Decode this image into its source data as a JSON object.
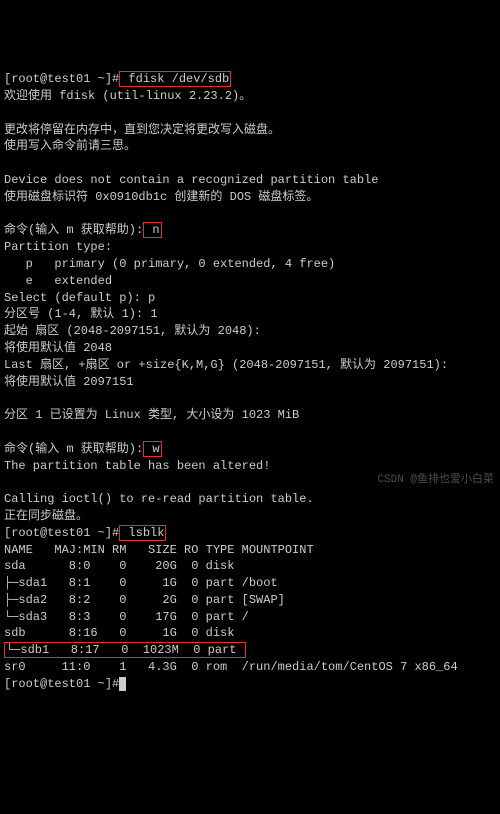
{
  "term": {
    "prompt1_prefix": "[root@test01 ~]#",
    "prompt1_suffix": "",
    "cmd_fdisk": " fdisk /dev/sdb",
    "welcome": "欢迎使用 fdisk (util-linux 2.23.2)。",
    "blank": "",
    "mem1": "更改将停留在内存中，直到您决定将更改写入磁盘。",
    "mem2": "使用写入命令前请三思。",
    "devwarn": "Device does not contain a recognized partition table",
    "devwarn2": "使用磁盘标识符 0x0910db1c 创建新的 DOS 磁盘标签。",
    "cmdprompt1a": "命令(输入 m 获取帮助):",
    "cmd_n": " n",
    "parttype": "Partition type:",
    "pt_p": "   p   primary (0 primary, 0 extended, 4 free)",
    "pt_e": "   e   extended",
    "select": "Select (default p): p",
    "partno": "分区号 (1-4, 默认 1): 1",
    "firstsector": "起始 扇区 (2048-2097151, 默认为 2048):",
    "usedefault1": "将使用默认值 2048",
    "lastsector": "Last 扇区, +扇区 or +size{K,M,G} (2048-2097151, 默认为 2097151):",
    "usedefault2": "将使用默认值 2097151",
    "setpart": "分区 1 已设置为 Linux 类型, 大小设为 1023 MiB",
    "cmdprompt2a": "命令(输入 m 获取帮助):",
    "cmd_w": " w",
    "altered": "The partition table has been altered!",
    "callioctl": "Calling ioctl() to re-read partition table.",
    "syncing": "正在同步磁盘。",
    "prompt2_prefix": "[root@test01 ~]#",
    "cmd_lsblk": " lsblk",
    "lsblk_header": "NAME   MAJ:MIN RM   SIZE RO TYPE MOUNTPOINT",
    "lsblk_sda": "sda      8:0    0    20G  0 disk ",
    "lsblk_sda1": "├─sda1   8:1    0     1G  0 part /boot",
    "lsblk_sda2": "├─sda2   8:2    0     2G  0 part [SWAP]",
    "lsblk_sda3": "└─sda3   8:3    0    17G  0 part /",
    "lsblk_sdb": "sdb      8:16   0     1G  0 disk ",
    "lsblk_sdb1": "└─sdb1   8:17   0  1023M  0 part ",
    "lsblk_sr0": "sr0     11:0    1   4.3G  0 rom  /run/media/tom/CentOS 7 x86_64",
    "prompt3_prefix": "[root@test01 ~]#",
    "cursor": " "
  },
  "watermark": "CSDN @鱼排也爱小白菜"
}
